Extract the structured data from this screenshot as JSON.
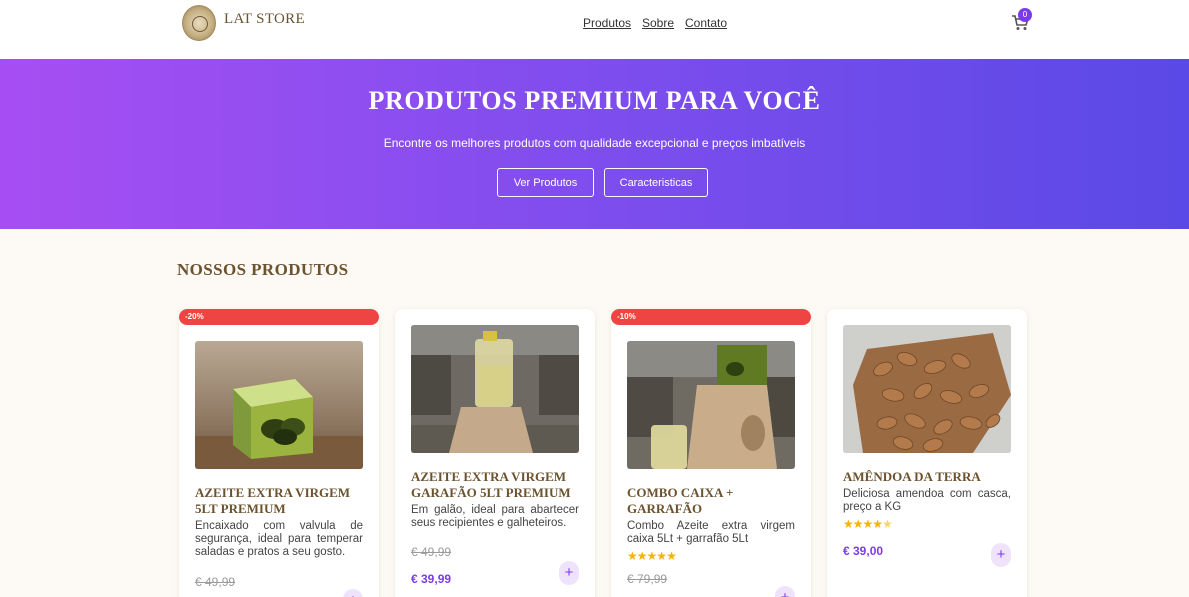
{
  "header": {
    "brand": "LAT STORE",
    "nav": [
      "Produtos",
      "Sobre",
      "Contato"
    ],
    "cart_count": "0"
  },
  "hero": {
    "title": "PRODUTOS PREMIUM PARA VOCÊ",
    "subtitle": "Encontre os melhores produtos com qualidade excepcional e preços imbatíveis",
    "buttons": [
      "Ver Produtos",
      "Caracteristicas"
    ]
  },
  "section": {
    "title": "NOSSOS PRODUTOS"
  },
  "products": [
    {
      "badge": "-20%",
      "title": "AZEITE EXTRA VIRGEM 5LT PREMIUM",
      "description": "Encaixado com valvula de segurança, ideal para temperar saladas e pratos a seu gosto.",
      "old_price": "€ 49,99",
      "price": "",
      "rating": null
    },
    {
      "badge": "",
      "title": "AZEITE EXTRA VIRGEM GARAFÃO 5LT PREMIUM",
      "description": "Em galão, ideal para abartecer seus recipientes e galheteiros.",
      "old_price": "€ 49,99",
      "price": "€ 39,99",
      "rating": null
    },
    {
      "badge": "-10%",
      "title": "COMBO CAIXA + GARRAFÃO",
      "description": "Combo Azeite extra virgem caixa 5Lt + garrafão 5Lt",
      "old_price": "€ 79,99",
      "price": "",
      "rating": 5
    },
    {
      "badge": "",
      "title": "AMÊNDOA DA TERRA",
      "description": "Deliciosa amendoa com casca, preço a KG",
      "old_price": "",
      "price": "€ 39,00",
      "rating": 4.5
    }
  ],
  "icons": {
    "cart": "cart-icon",
    "add": "plus-icon",
    "star": "star-icon"
  },
  "colors": {
    "accent": "#7c3aed",
    "brand": "#6b5330",
    "badge": "#ef4444",
    "hero_start": "#a64ef3",
    "hero_end": "#5a49e6"
  }
}
